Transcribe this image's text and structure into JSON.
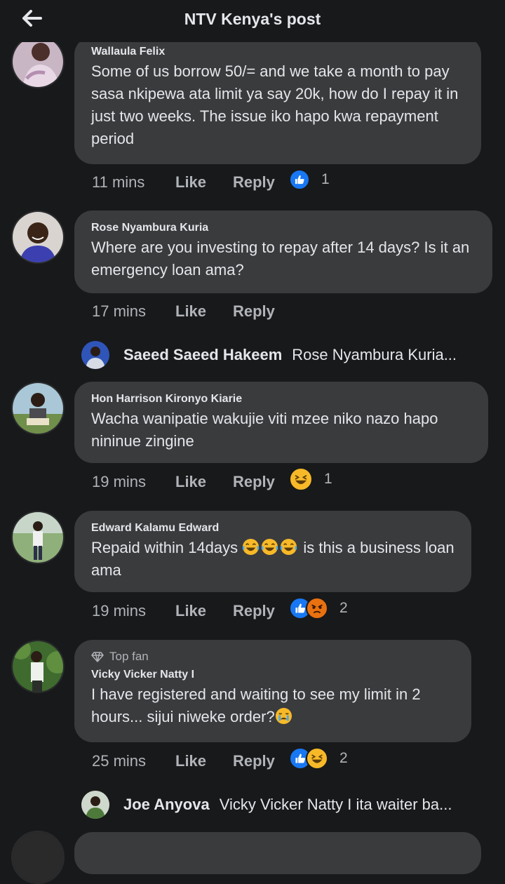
{
  "header": {
    "title": "NTV Kenya's post",
    "back_icon": "back-arrow-icon"
  },
  "comments": [
    {
      "author": "Wallaula Felix",
      "text": "Some of us borrow 50/= and we take a month to pay sasa nkipewa ata limit ya say 20k, how do I repay it in just two weeks. The issue iko hapo kwa repayment period",
      "time": "11 mins",
      "like": "Like",
      "reply": "Reply",
      "reactions": [
        "like-reaction-icon"
      ],
      "reaction_count": "1"
    },
    {
      "author": "Rose Nyambura Kuria",
      "text": "Where are you investing to repay after 14 days? Is it an emergency loan ama?",
      "time": "17 mins",
      "like": "Like",
      "reply": "Reply",
      "reply_preview": {
        "name": "Saeed Saeed Hakeem",
        "text": "Rose Nyambura Kuria..."
      }
    },
    {
      "author": "Hon Harrison Kironyo Kiarie",
      "text": "Wacha wanipatie wakujie viti mzee niko nazo hapo nininue zingine",
      "time": "19 mins",
      "like": "Like",
      "reply": "Reply",
      "reactions": [
        "haha-reaction-icon"
      ],
      "reaction_count": "1"
    },
    {
      "author": "Edward Kalamu Edward",
      "text_before": "Repaid within 14days",
      "emoji": [
        "tears-of-joy-icon",
        "tears-of-joy-icon",
        "tears-of-joy-icon"
      ],
      "text_after": "is this a business loan ama",
      "time": "19 mins",
      "like": "Like",
      "reply": "Reply",
      "reactions": [
        "like-reaction-icon",
        "angry-reaction-icon"
      ],
      "reaction_count": "2"
    },
    {
      "badge": "Top fan",
      "author": "Vicky Vicker Natty I",
      "text": "I have registered and waiting to see my limit in 2 hours... sijui niweke order?",
      "emoji": [
        "crying-face-icon"
      ],
      "time": "25 mins",
      "like": "Like",
      "reply": "Reply",
      "reactions": [
        "like-reaction-icon",
        "haha-reaction-icon"
      ],
      "reaction_count": "2",
      "reply_preview": {
        "name": "Joe Anyova",
        "text": "Vicky Vicker Natty I ita waiter ba..."
      }
    }
  ],
  "colors": {
    "background": "#18191a",
    "bubble": "#3a3b3c",
    "text": "#e4e6eb",
    "muted": "#b0b3b8",
    "like_blue": "#1877f2",
    "emoji_yellow": "#f7b928",
    "angry_red": "#e9710f"
  }
}
